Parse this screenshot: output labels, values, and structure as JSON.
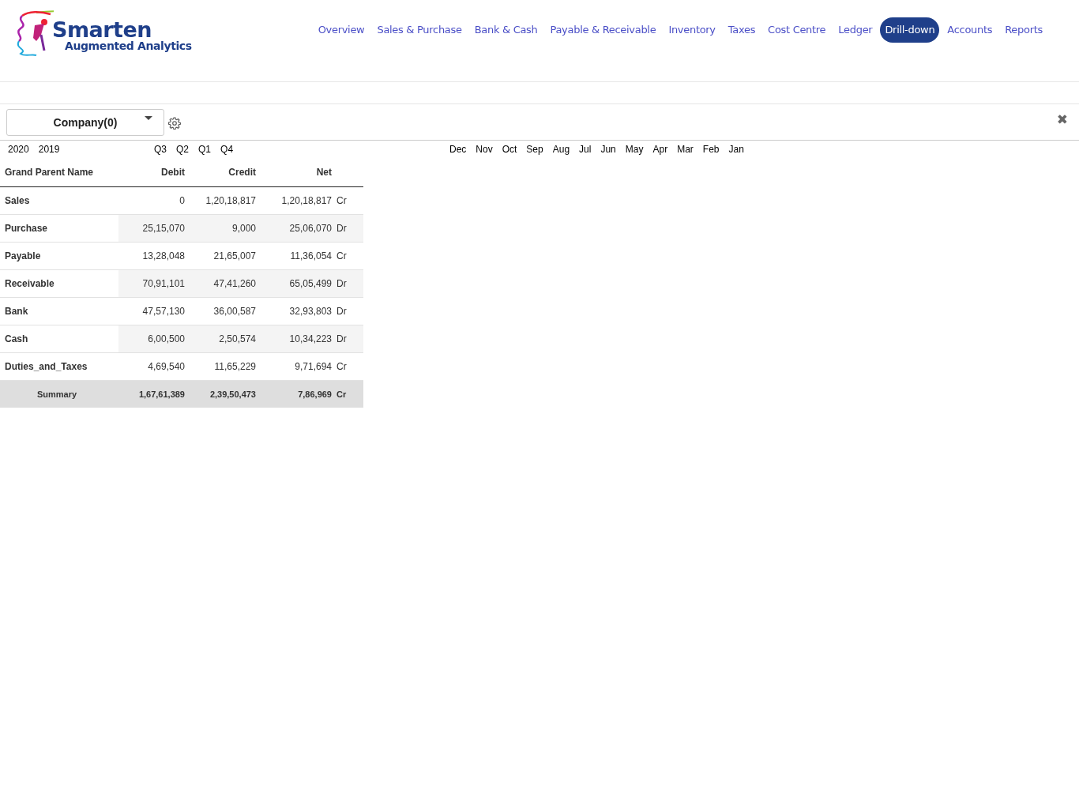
{
  "logo": {
    "title": "Smarten",
    "subtitle": "Augmented Analytics"
  },
  "nav": [
    {
      "label": "Overview",
      "selected": false
    },
    {
      "label": "Sales & Purchase",
      "selected": false
    },
    {
      "label": "Bank & Cash",
      "selected": false
    },
    {
      "label": "Payable & Receivable",
      "selected": false
    },
    {
      "label": "Inventory",
      "selected": false
    },
    {
      "label": "Taxes",
      "selected": false
    },
    {
      "label": "Cost Centre",
      "selected": false
    },
    {
      "label": "Ledger",
      "selected": false
    },
    {
      "label": "Drill-down",
      "selected": true
    },
    {
      "label": "Accounts",
      "selected": false
    },
    {
      "label": "Reports",
      "selected": false
    }
  ],
  "company_select": {
    "value": "Company(0)"
  },
  "filters": {
    "years": [
      "2020",
      "2019"
    ],
    "quarters": [
      "Q3",
      "Q2",
      "Q1",
      "Q4"
    ],
    "months": [
      "Dec",
      "Nov",
      "Oct",
      "Sep",
      "Aug",
      "Jul",
      "Jun",
      "May",
      "Apr",
      "Mar",
      "Feb",
      "Jan"
    ]
  },
  "table": {
    "columns": [
      "Grand Parent Name",
      "Debit",
      "Credit",
      "Net"
    ],
    "rows": [
      {
        "name": "Sales",
        "debit": "0",
        "credit": "1,20,18,817",
        "net": "1,20,18,817",
        "side": "Cr"
      },
      {
        "name": "Purchase",
        "debit": "25,15,070",
        "credit": "9,000",
        "net": "25,06,070",
        "side": "Dr"
      },
      {
        "name": "Payable",
        "debit": "13,28,048",
        "credit": "21,65,007",
        "net": "11,36,054",
        "side": "Cr"
      },
      {
        "name": "Receivable",
        "debit": "70,91,101",
        "credit": "47,41,260",
        "net": "65,05,499",
        "side": "Dr"
      },
      {
        "name": "Bank",
        "debit": "47,57,130",
        "credit": "36,00,587",
        "net": "32,93,803",
        "side": "Dr"
      },
      {
        "name": "Cash",
        "debit": "6,00,500",
        "credit": "2,50,574",
        "net": "10,34,223",
        "side": "Dr"
      },
      {
        "name": "Duties_and_Taxes",
        "debit": "4,69,540",
        "credit": "11,65,229",
        "net": "9,71,694",
        "side": "Cr"
      }
    ],
    "summary": {
      "name": "Summary",
      "debit": "1,67,61,389",
      "credit": "2,39,50,473",
      "net": "7,86,969",
      "side": "Cr"
    }
  },
  "close_button": {
    "label": "✖"
  }
}
